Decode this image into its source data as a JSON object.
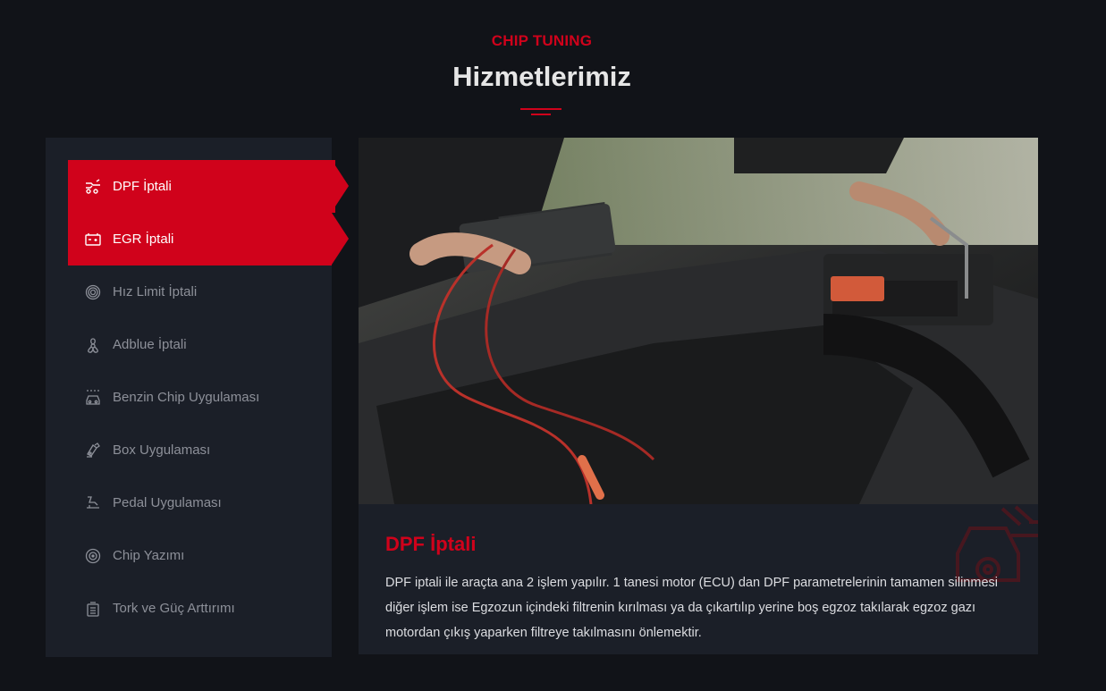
{
  "header": {
    "eyebrow": "CHIP TUNING",
    "title": "Hizmetlerimiz"
  },
  "colors": {
    "accent": "#d0021b",
    "background": "#111318",
    "panel": "#1b1f28",
    "muted_text": "#8d9099"
  },
  "menu": {
    "items": [
      {
        "label": "DPF İptali",
        "icon": "exhaust-filter-icon",
        "active": true
      },
      {
        "label": "EGR İptali",
        "icon": "battery-icon",
        "active": true
      },
      {
        "label": "Hız Limit İptali",
        "icon": "speed-dial-icon",
        "active": false
      },
      {
        "label": "Adblue İptali",
        "icon": "fan-icon",
        "active": false
      },
      {
        "label": "Benzin Chip Uygulaması",
        "icon": "car-chip-icon",
        "active": false
      },
      {
        "label": "Box Uygulaması",
        "icon": "box-tool-icon",
        "active": false
      },
      {
        "label": "Pedal Uygulaması",
        "icon": "pedal-icon",
        "active": false
      },
      {
        "label": "Chip Yazımı",
        "icon": "chip-target-icon",
        "active": false
      },
      {
        "label": "Tork ve Güç Arttırımı",
        "icon": "engine-icon",
        "active": false
      }
    ]
  },
  "detail": {
    "image_subject": "mechanic testing car battery under hood",
    "title": "DPF İptali",
    "description": "DPF iptali ile araçta ana 2 işlem yapılır. 1 tanesi motor (ECU) dan DPF parametrelerinin tamamen silinmesi diğer işlem ise Egzozun içindeki filtrenin kırılması ya da çıkartılıp yerine boş egzoz takılarak egzoz gazı motordan çıkış yaparken filtreye takılmasını önlemektir.",
    "watermark_icon": "car-exhaust-icon"
  }
}
